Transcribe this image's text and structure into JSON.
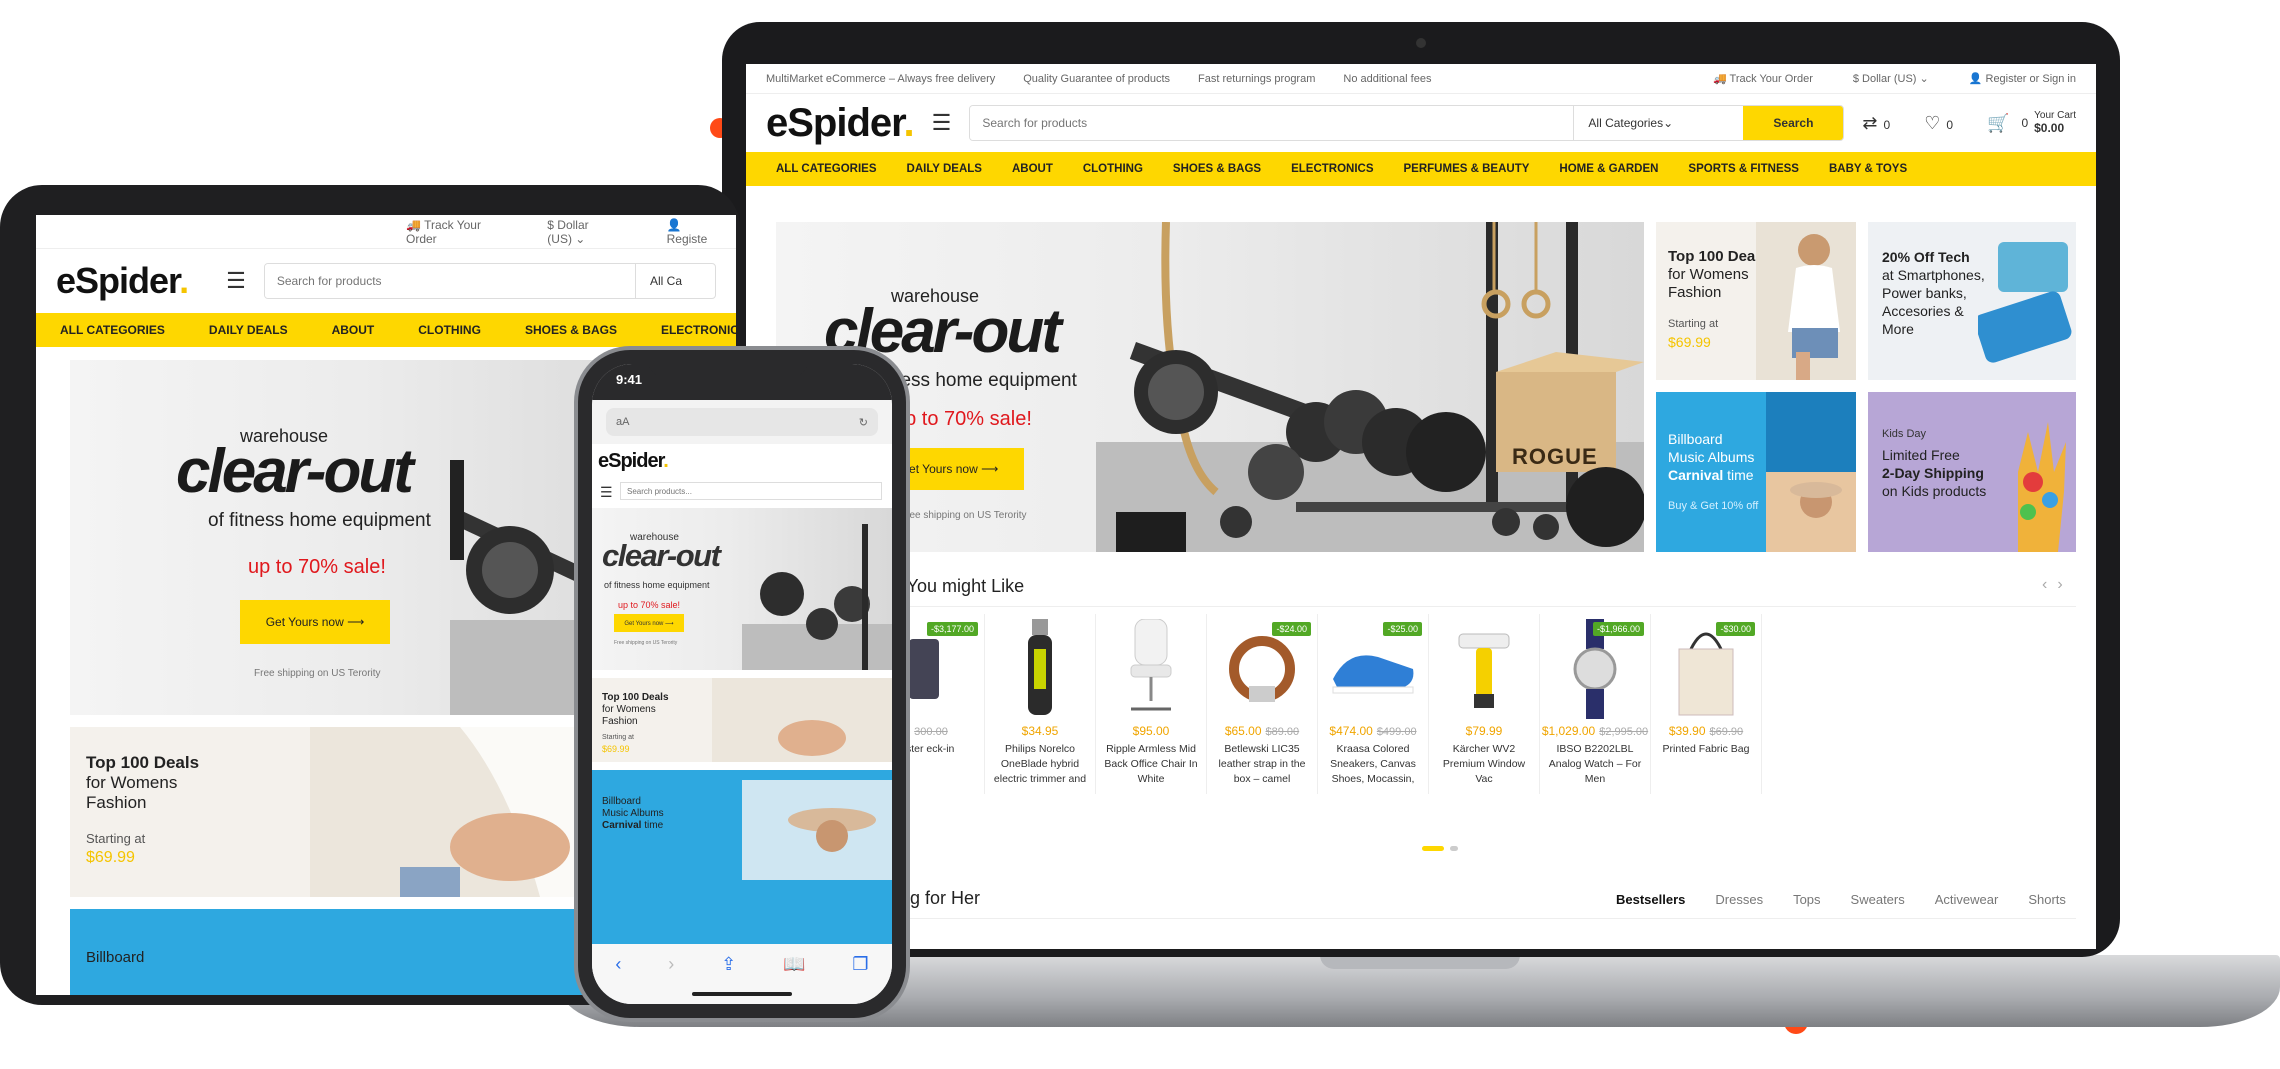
{
  "brand": {
    "logo": "eSpider",
    "logo_dot": ".",
    "accent": "#fed700",
    "sale_red": "#e0181d",
    "badge_green": "#52a825"
  },
  "topbar": {
    "left": [
      "MultiMarket eCommerce – Always free delivery",
      "Quality Guarantee of products",
      "Fast returnings program",
      "No additional fees"
    ],
    "track": "Track Your Order",
    "currency": "$ Dollar (US)",
    "account": "Register or Sign in"
  },
  "header": {
    "search_placeholder": "Search for products",
    "category": "All Categories",
    "search_button": "Search",
    "compare_count": "0",
    "wishlist_count": "0",
    "cart_count": "0",
    "cart_label": "Your Cart",
    "cart_total": "$0.00"
  },
  "nav": [
    "ALL CATEGORIES",
    "DAILY DEALS",
    "ABOUT",
    "CLOTHING",
    "SHOES & BAGS",
    "ELECTRONICS",
    "PERFUMES & BEAUTY",
    "HOME & GARDEN",
    "SPORTS & FITNESS",
    "BABY & TOYS"
  ],
  "hero": {
    "line1": "warehouse",
    "line2": "clear-out",
    "line3": "of fitness home equipment",
    "line4": "up to 70% sale!",
    "cta": "Get Yours now ⟶",
    "footnote": "Free shipping on US Terority",
    "equipment_label": "ROGUE"
  },
  "promos": {
    "deals": {
      "title1": "Top 100 Deals",
      "title2": "for Womens",
      "title3": "Fashion",
      "starting": "Starting at",
      "price": "$69.99"
    },
    "tech": {
      "title1": "20% Off Tech",
      "title2": "at Smartphones,",
      "title3": "Power banks,",
      "title4": "Accesories &",
      "title5": "More"
    },
    "music": {
      "title1": "Billboard",
      "title2": "Music Albums",
      "title3_bold": "Carnival",
      "title3_rest": " time",
      "note": "Buy & Get 10% off"
    },
    "kids": {
      "tag": "Kids Day",
      "title1": "Limited Free",
      "title2": "2-Day Shipping",
      "title3": "on Kids products"
    }
  },
  "arrivals": {
    "title": "ivals You might Like",
    "products": [
      {
        "badge": "-$3,177.00",
        "price": "",
        "old": "300.00",
        "name": "ister eck-in"
      },
      {
        "badge": "",
        "price": "$34.95",
        "old": "",
        "name": "Philips Norelco OneBlade hybrid electric trimmer and"
      },
      {
        "badge": "",
        "price": "$95.00",
        "old": "",
        "name": "Ripple Armless Mid Back Office Chair In White"
      },
      {
        "badge": "-$24.00",
        "price": "$65.00",
        "old": "$89.00",
        "name": "Betlewski LIC35 leather strap in the box – camel"
      },
      {
        "badge": "-$25.00",
        "price": "$474.00",
        "old": "$499.00",
        "name": "Kraasa Colored Sneakers, Canvas Shoes, Mocassin,"
      },
      {
        "badge": "",
        "price": "$79.99",
        "old": "",
        "name": "Kärcher WV2 Premium Window Vac"
      },
      {
        "badge": "-$1,966.00",
        "price": "$1,029.00",
        "old": "$2,995.00",
        "name": "IBSO B2202LBL Analog Watch – For Men"
      },
      {
        "badge": "-$30.00",
        "price": "$39.90",
        "old": "$69.90",
        "name": "Printed Fabric Bag"
      }
    ]
  },
  "clothing": {
    "title": "hing for Her",
    "tabs": [
      "Bestsellers",
      "Dresses",
      "Tops",
      "Sweaters",
      "Activewear",
      "Shorts"
    ]
  },
  "tablet": {
    "track": "Track Your Order",
    "currency": "$ Dollar (US)",
    "account": "Registe",
    "search_placeholder": "Search for products",
    "category": "All Ca",
    "nav": [
      "ALL CATEGORIES",
      "DAILY DEALS",
      "ABOUT",
      "CLOTHING",
      "SHOES & BAGS",
      "ELECTRONICS"
    ],
    "billboard": "Billboard"
  },
  "phone": {
    "time": "9:41",
    "url_aa": "aA",
    "search_placeholder": "Search products..."
  },
  "icons": [
    "truck-icon",
    "dollar-icon",
    "user-icon",
    "compare-icon",
    "heart-icon",
    "cart-icon",
    "hamburger-icon",
    "reload-icon",
    "share-icon",
    "book-icon",
    "tabs-icon"
  ]
}
